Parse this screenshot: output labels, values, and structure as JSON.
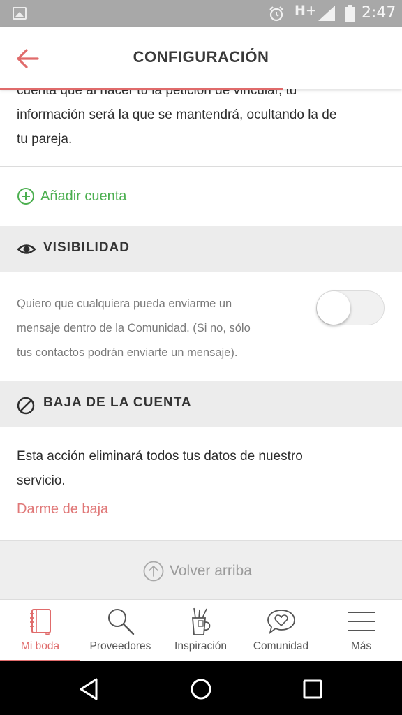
{
  "status_bar": {
    "network": "H+",
    "time": "2:47"
  },
  "header": {
    "title": "CONFIGURACIÓN"
  },
  "linked_account": {
    "intro_lines": [
      "cuenta que al hacer tú la petición de vincular, tu",
      "información será la que se mantendrá, ocultando la de",
      "tu pareja."
    ],
    "add_account_label": "Añadir cuenta"
  },
  "visibility": {
    "title": "VISIBILIDAD",
    "lines": [
      "Quiero que cualquiera pueda enviarme un",
      "mensaje dentro de la Comunidad. (Si no, sólo",
      "tus contactos podrán enviarte un mensaje)."
    ],
    "toggle_on": false
  },
  "account_removal": {
    "title": "BAJA DE LA CUENTA",
    "lines": [
      "Esta acción eliminará todos tus datos de nuestro",
      "servicio."
    ],
    "link_label": "Darme de baja"
  },
  "back_to_top": "Volver arriba",
  "bottom_nav": {
    "items": [
      {
        "label": "Mi boda",
        "icon": "notebook-icon",
        "active": true
      },
      {
        "label": "Proveedores",
        "icon": "magnifier-icon",
        "active": false
      },
      {
        "label": "Inspiración",
        "icon": "cup-icon",
        "active": false
      },
      {
        "label": "Comunidad",
        "icon": "chat-heart-icon",
        "active": false
      },
      {
        "label": "Más",
        "icon": "menu-icon",
        "active": false
      }
    ]
  },
  "colors": {
    "accent_red": "#e06b6b",
    "accent_green": "#4caf50",
    "section_bg": "#ececec"
  }
}
